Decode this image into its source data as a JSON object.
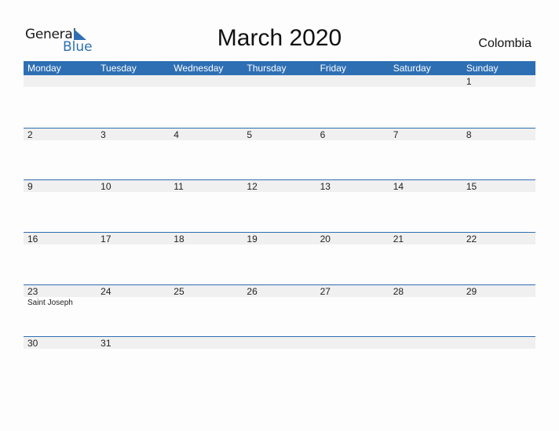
{
  "logo": {
    "word1": "General",
    "word2": "Blue"
  },
  "title": "March 2020",
  "country": "Colombia",
  "colors": {
    "accent": "#2e6fb4",
    "band": "#f0f0f0"
  },
  "weekdays": [
    "Monday",
    "Tuesday",
    "Wednesday",
    "Thursday",
    "Friday",
    "Saturday",
    "Sunday"
  ],
  "weeks": [
    {
      "days": [
        "",
        "",
        "",
        "",
        "",
        "",
        "1"
      ],
      "holidays": [
        "",
        "",
        "",
        "",
        "",
        "",
        ""
      ]
    },
    {
      "days": [
        "2",
        "3",
        "4",
        "5",
        "6",
        "7",
        "8"
      ],
      "holidays": [
        "",
        "",
        "",
        "",
        "",
        "",
        ""
      ]
    },
    {
      "days": [
        "9",
        "10",
        "11",
        "12",
        "13",
        "14",
        "15"
      ],
      "holidays": [
        "",
        "",
        "",
        "",
        "",
        "",
        ""
      ]
    },
    {
      "days": [
        "16",
        "17",
        "18",
        "19",
        "20",
        "21",
        "22"
      ],
      "holidays": [
        "",
        "",
        "",
        "",
        "",
        "",
        ""
      ]
    },
    {
      "days": [
        "23",
        "24",
        "25",
        "26",
        "27",
        "28",
        "29"
      ],
      "holidays": [
        "Saint Joseph",
        "",
        "",
        "",
        "",
        "",
        ""
      ]
    },
    {
      "days": [
        "30",
        "31",
        "",
        "",
        "",
        "",
        ""
      ],
      "holidays": [
        "",
        "",
        "",
        "",
        "",
        "",
        ""
      ]
    }
  ]
}
